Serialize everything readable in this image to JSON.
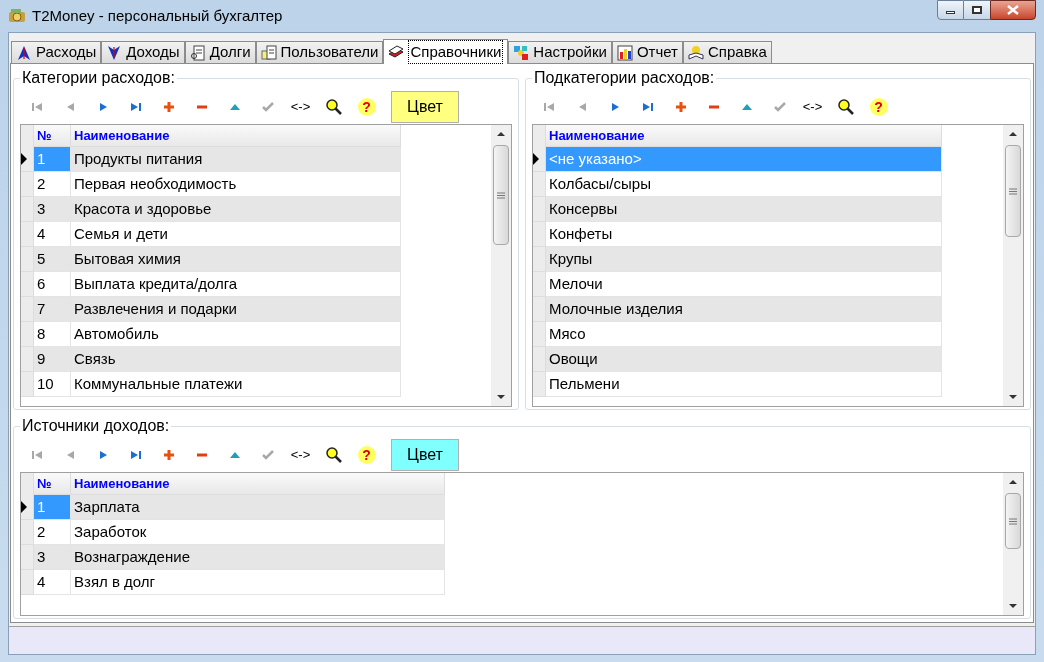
{
  "window": {
    "title": "T2Money - персональный бухгалтер"
  },
  "tabs": [
    {
      "kind": "expenses",
      "label": "Расходы",
      "selected": false
    },
    {
      "kind": "income",
      "label": "Доходы",
      "selected": false
    },
    {
      "kind": "debts",
      "label": "Долги",
      "selected": false
    },
    {
      "kind": "users",
      "label": "Пользователи",
      "selected": false
    },
    {
      "kind": "reference",
      "label": "Справочники",
      "selected": true
    },
    {
      "kind": "settings",
      "label": "Настройки",
      "selected": false
    },
    {
      "kind": "report",
      "label": "Отчет",
      "selected": false
    },
    {
      "kind": "help",
      "label": "Справка",
      "selected": false
    }
  ],
  "panels": [
    {
      "title": "Категории расходов:",
      "toolbar": [
        {
          "kind": "first",
          "disabled": true
        },
        {
          "kind": "prior",
          "disabled": true
        },
        {
          "kind": "next",
          "disabled": false
        },
        {
          "kind": "last",
          "disabled": false
        },
        {
          "kind": "insert",
          "disabled": false
        },
        {
          "kind": "delete",
          "disabled": false
        },
        {
          "kind": "edit",
          "disabled": false
        },
        {
          "kind": "post",
          "disabled": true
        },
        {
          "kind": "cancel",
          "label": "<->",
          "disabled": false
        },
        {
          "kind": "search",
          "disabled": false
        },
        {
          "kind": "help",
          "label": "?",
          "disabled": false
        }
      ],
      "color_button": {
        "label": "Цвет",
        "color": "#ffff80"
      },
      "table": {
        "columns": [
          "№",
          "Наименование"
        ],
        "rows": [
          {
            "cells": [
              "1",
              "Продукты питания"
            ],
            "selected": true
          },
          {
            "cells": [
              "2",
              "Первая необходимость"
            ],
            "selected": false
          },
          {
            "cells": [
              "3",
              "Красота и здоровье"
            ],
            "selected": false
          },
          {
            "cells": [
              "4",
              "Семья и дети"
            ],
            "selected": false
          },
          {
            "cells": [
              "5",
              "Бытовая химия"
            ],
            "selected": false
          },
          {
            "cells": [
              "6",
              "Выплата кредита/долга"
            ],
            "selected": false
          },
          {
            "cells": [
              "7",
              "Развлечения и подарки"
            ],
            "selected": false
          },
          {
            "cells": [
              "8",
              "Автомобиль"
            ],
            "selected": false
          },
          {
            "cells": [
              "9",
              "Связь"
            ],
            "selected": false
          },
          {
            "cells": [
              "10",
              "Коммунальные платежи"
            ],
            "selected": false
          }
        ]
      }
    },
    {
      "title": "Подкатегории расходов:",
      "toolbar": [
        {
          "kind": "first",
          "disabled": true
        },
        {
          "kind": "prior",
          "disabled": true
        },
        {
          "kind": "next",
          "disabled": false
        },
        {
          "kind": "last",
          "disabled": false
        },
        {
          "kind": "insert",
          "disabled": false
        },
        {
          "kind": "delete",
          "disabled": false
        },
        {
          "kind": "edit",
          "disabled": false
        },
        {
          "kind": "post",
          "disabled": true
        },
        {
          "kind": "cancel",
          "label": "<->",
          "disabled": false
        },
        {
          "kind": "search",
          "disabled": false
        },
        {
          "kind": "help",
          "label": "?",
          "disabled": false
        }
      ],
      "table": {
        "columns": [
          "Наименование"
        ],
        "rows": [
          {
            "cells": [
              "<не указано>"
            ],
            "selected": true
          },
          {
            "cells": [
              "Колбасы/сыры"
            ],
            "selected": false
          },
          {
            "cells": [
              "Консервы"
            ],
            "selected": false
          },
          {
            "cells": [
              "Конфеты"
            ],
            "selected": false
          },
          {
            "cells": [
              "Крупы"
            ],
            "selected": false
          },
          {
            "cells": [
              "Мелочи"
            ],
            "selected": false
          },
          {
            "cells": [
              "Молочные изделия"
            ],
            "selected": false
          },
          {
            "cells": [
              "Мясо"
            ],
            "selected": false
          },
          {
            "cells": [
              "Овощи"
            ],
            "selected": false
          },
          {
            "cells": [
              "Пельмени"
            ],
            "selected": false
          }
        ]
      }
    },
    {
      "title": "Источники доходов:",
      "toolbar": [
        {
          "kind": "first",
          "disabled": true
        },
        {
          "kind": "prior",
          "disabled": true
        },
        {
          "kind": "next",
          "disabled": false
        },
        {
          "kind": "last",
          "disabled": false
        },
        {
          "kind": "insert",
          "disabled": false
        },
        {
          "kind": "delete",
          "disabled": false
        },
        {
          "kind": "edit",
          "disabled": false
        },
        {
          "kind": "post",
          "disabled": true
        },
        {
          "kind": "cancel",
          "label": "<->",
          "disabled": false
        },
        {
          "kind": "search",
          "disabled": false
        },
        {
          "kind": "help",
          "label": "?",
          "disabled": false
        }
      ],
      "color_button": {
        "label": "Цвет",
        "color": "#80ffff"
      },
      "table": {
        "columns": [
          "№",
          "Наименование"
        ],
        "rows": [
          {
            "cells": [
              "1",
              "Зарплата"
            ],
            "selected": true
          },
          {
            "cells": [
              "2",
              "Заработок"
            ],
            "selected": false
          },
          {
            "cells": [
              "3",
              "Вознаграждение"
            ],
            "selected": false
          },
          {
            "cells": [
              "4",
              "Взял в долг"
            ],
            "selected": false
          }
        ]
      }
    }
  ]
}
